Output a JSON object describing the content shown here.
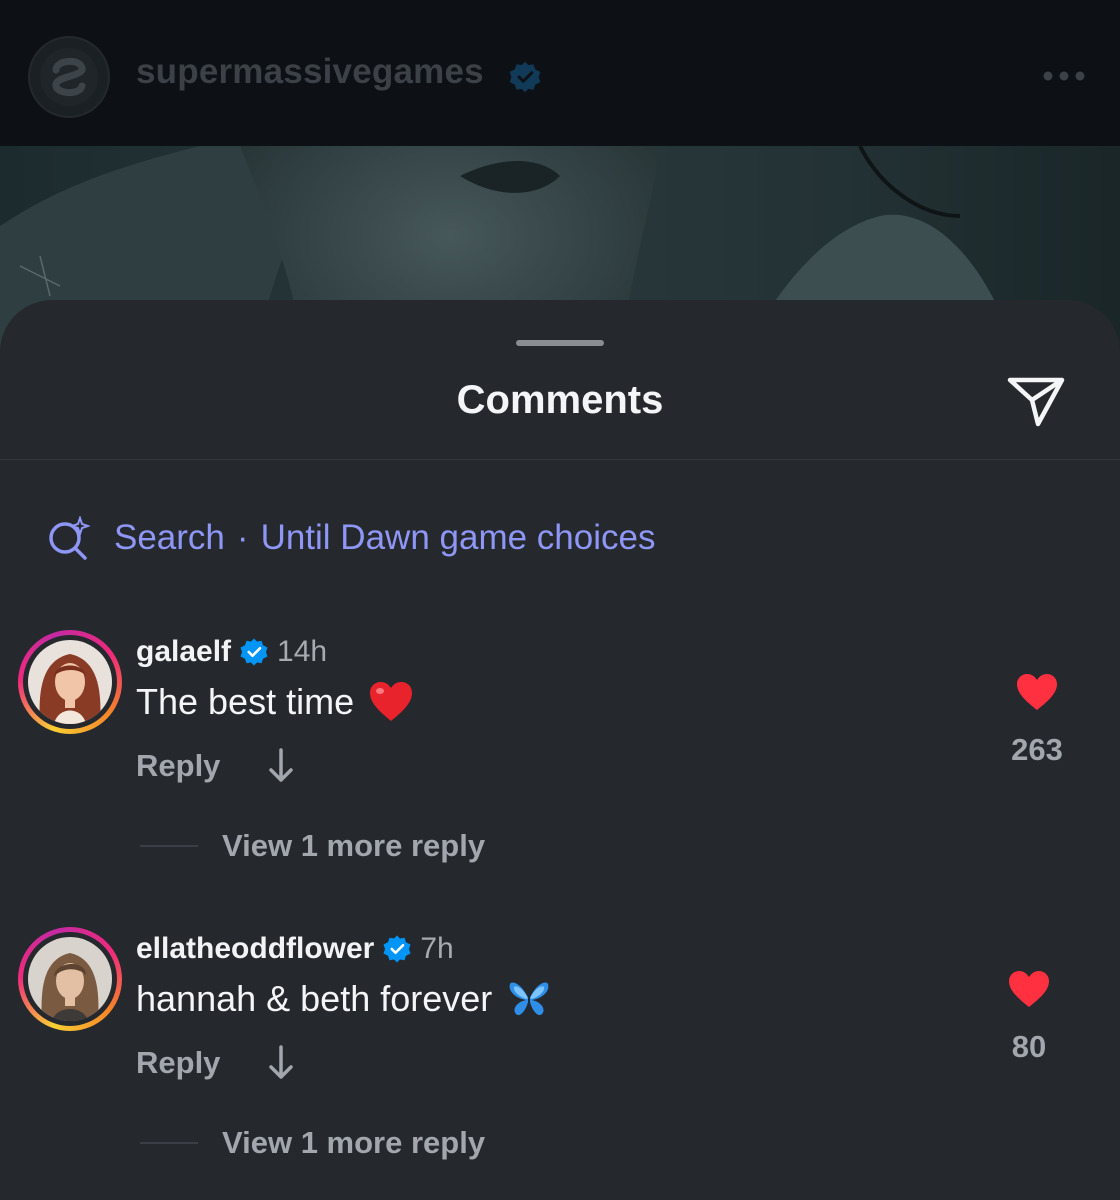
{
  "post": {
    "username": "supermassivegames",
    "verified": true
  },
  "comments_sheet": {
    "title": "Comments",
    "search": {
      "label": "Search",
      "separator": "·",
      "query": "Until Dawn game choices"
    }
  },
  "comments": [
    {
      "username": "galaelf",
      "verified": true,
      "time": "14h",
      "text": "The best time",
      "emoji": "red-heart",
      "reply_label": "Reply",
      "likes": "263",
      "liked": true,
      "view_replies_label": "View 1 more reply"
    },
    {
      "username": "ellatheoddflower",
      "verified": true,
      "time": "7h",
      "text": "hannah & beth forever",
      "emoji": "blue-butterfly",
      "reply_label": "Reply",
      "likes": "80",
      "liked": true,
      "view_replies_label": "View 1 more reply"
    }
  ],
  "colors": {
    "accent_search": "#8e96f6",
    "like_red": "#ff3040",
    "verified_blue": "#0095f6",
    "sheet_bg": "#25282d"
  }
}
